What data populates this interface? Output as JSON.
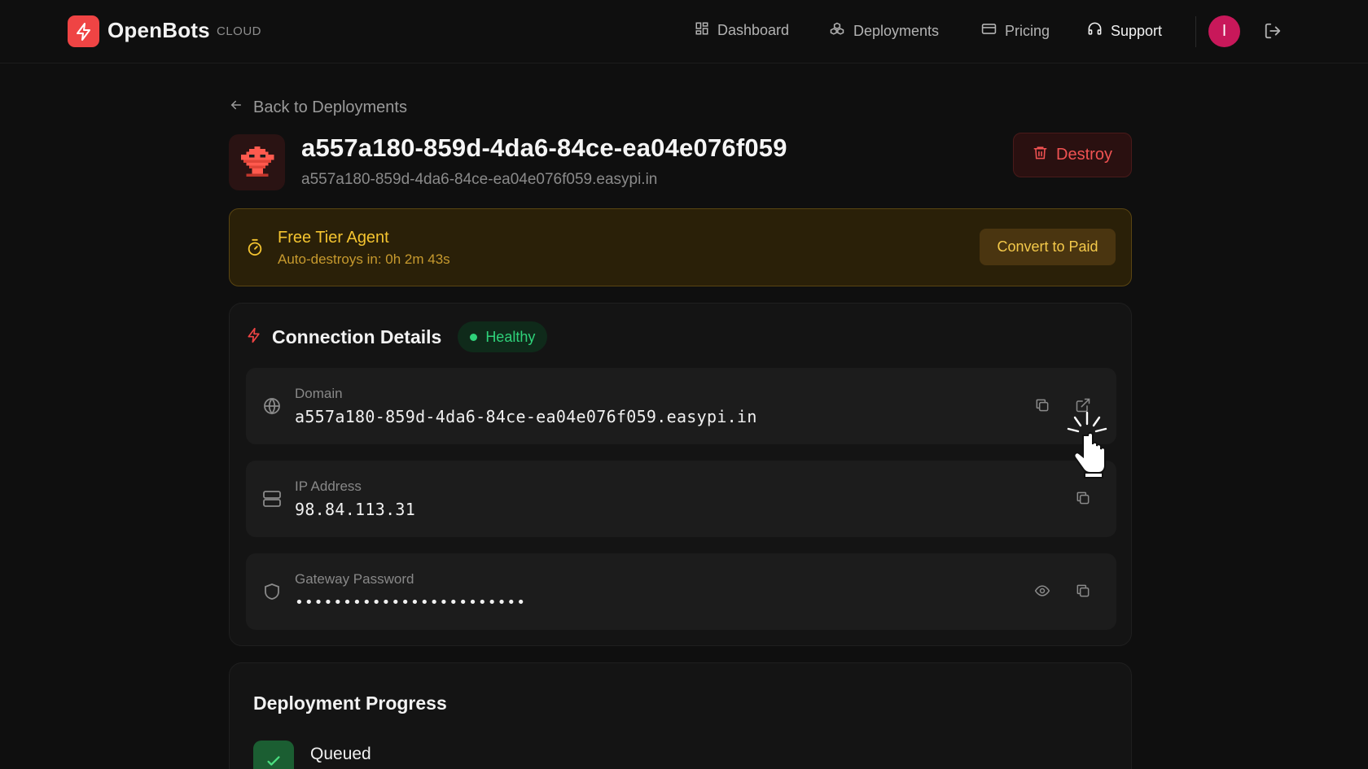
{
  "header": {
    "brand": "OpenBots",
    "brand_sub": "CLOUD",
    "nav": [
      {
        "label": "Dashboard",
        "icon": "grid-icon"
      },
      {
        "label": "Deployments",
        "icon": "cubes-icon"
      },
      {
        "label": "Pricing",
        "icon": "card-icon"
      },
      {
        "label": "Support",
        "icon": "headset-icon"
      }
    ],
    "avatar_initial": "I"
  },
  "page": {
    "back_label": "Back to Deployments",
    "title": "a557a180-859d-4da6-84ce-ea04e076f059",
    "subtitle": "a557a180-859d-4da6-84ce-ea04e076f059.easypi.in",
    "destroy_label": "Destroy"
  },
  "free_tier": {
    "title": "Free Tier Agent",
    "countdown": "Auto-destroys in: 0h 2m 43s",
    "convert_label": "Convert to Paid"
  },
  "connection": {
    "title": "Connection Details",
    "status": "Healthy",
    "rows": [
      {
        "label": "Domain",
        "value": "a557a180-859d-4da6-84ce-ea04e076f059.easypi.in"
      },
      {
        "label": "IP Address",
        "value": "98.84.113.31"
      },
      {
        "label": "Gateway Password",
        "value": "••••••••••••••••••••••••"
      }
    ]
  },
  "progress": {
    "title": "Deployment Progress",
    "steps": [
      {
        "label": "Queued"
      }
    ]
  },
  "colors": {
    "accent": "#ef4444",
    "healthy": "#2fd27a",
    "warning": "#f4c430"
  }
}
